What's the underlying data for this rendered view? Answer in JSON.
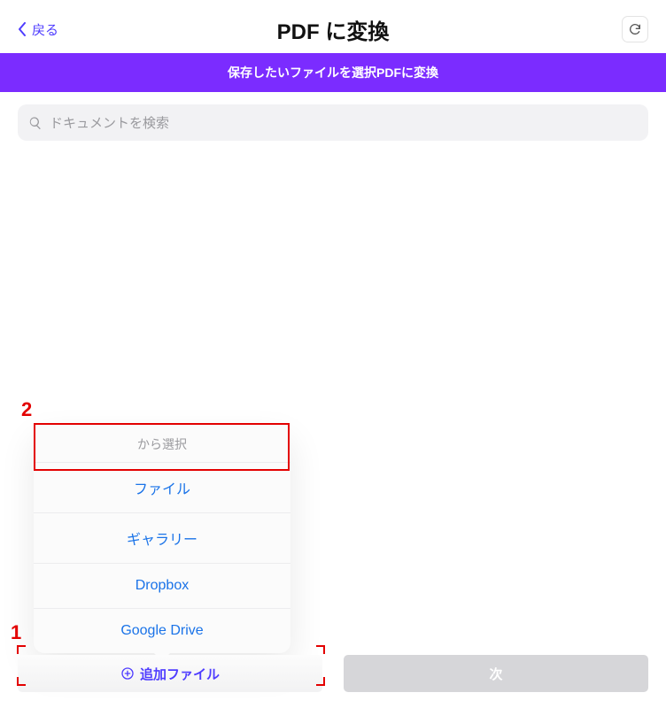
{
  "header": {
    "back_label": "戻る",
    "title": "PDF に変換"
  },
  "banner": {
    "text": "保存したいファイルを選択PDFに変換"
  },
  "search": {
    "placeholder": "ドキュメントを検索"
  },
  "popup": {
    "heading": "から選択",
    "items": [
      "ファイル",
      "ギャラリー",
      "Dropbox",
      "Google Drive"
    ]
  },
  "bottom": {
    "add_label": "追加ファイル",
    "next_label": "次"
  },
  "annotations": {
    "one": "1",
    "two": "2"
  }
}
